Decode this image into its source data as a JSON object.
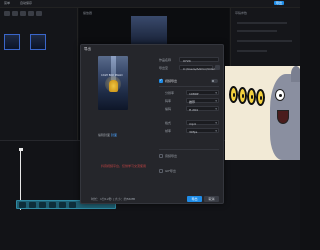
{
  "editor": {
    "menu": [
      "菜单",
      "自动保存",
      "导出"
    ],
    "preview_label": "播放器",
    "right_title": "草稿参数"
  },
  "dialog": {
    "title": "导出",
    "cover": {
      "caption": "CASH BOX MAGIC",
      "edit_prefix": "编辑封面",
      "edit_link": "封面"
    },
    "name_label": "作品名称",
    "name_value": "0724",
    "path_label": "导出至",
    "path_value": "C:/Users/Admin/Videos",
    "video_section": {
      "label": "视频导出",
      "checked": true
    },
    "settings": [
      {
        "label": "分辨率",
        "value": "1080P"
      },
      {
        "label": "码率",
        "value": "推荐"
      },
      {
        "label": "编码",
        "value": "H.264"
      },
      {
        "label": "格式",
        "value": "mp4"
      },
      {
        "label": "帧率",
        "value": "30fps"
      }
    ],
    "audio_section": {
      "label": "音频导出",
      "checked": false
    },
    "gif_section": {
      "label": "GIF导出",
      "checked": false
    },
    "watermark_tip": "抖音视频平台，仅供学习交流使用",
    "duration": "时长：1分12秒 | 大小：约56MB",
    "export_label": "导出",
    "cancel_label": "取消"
  },
  "colors": {
    "accent": "#1f8de8",
    "clip": "#1f5f72",
    "warning": "#c44444"
  }
}
